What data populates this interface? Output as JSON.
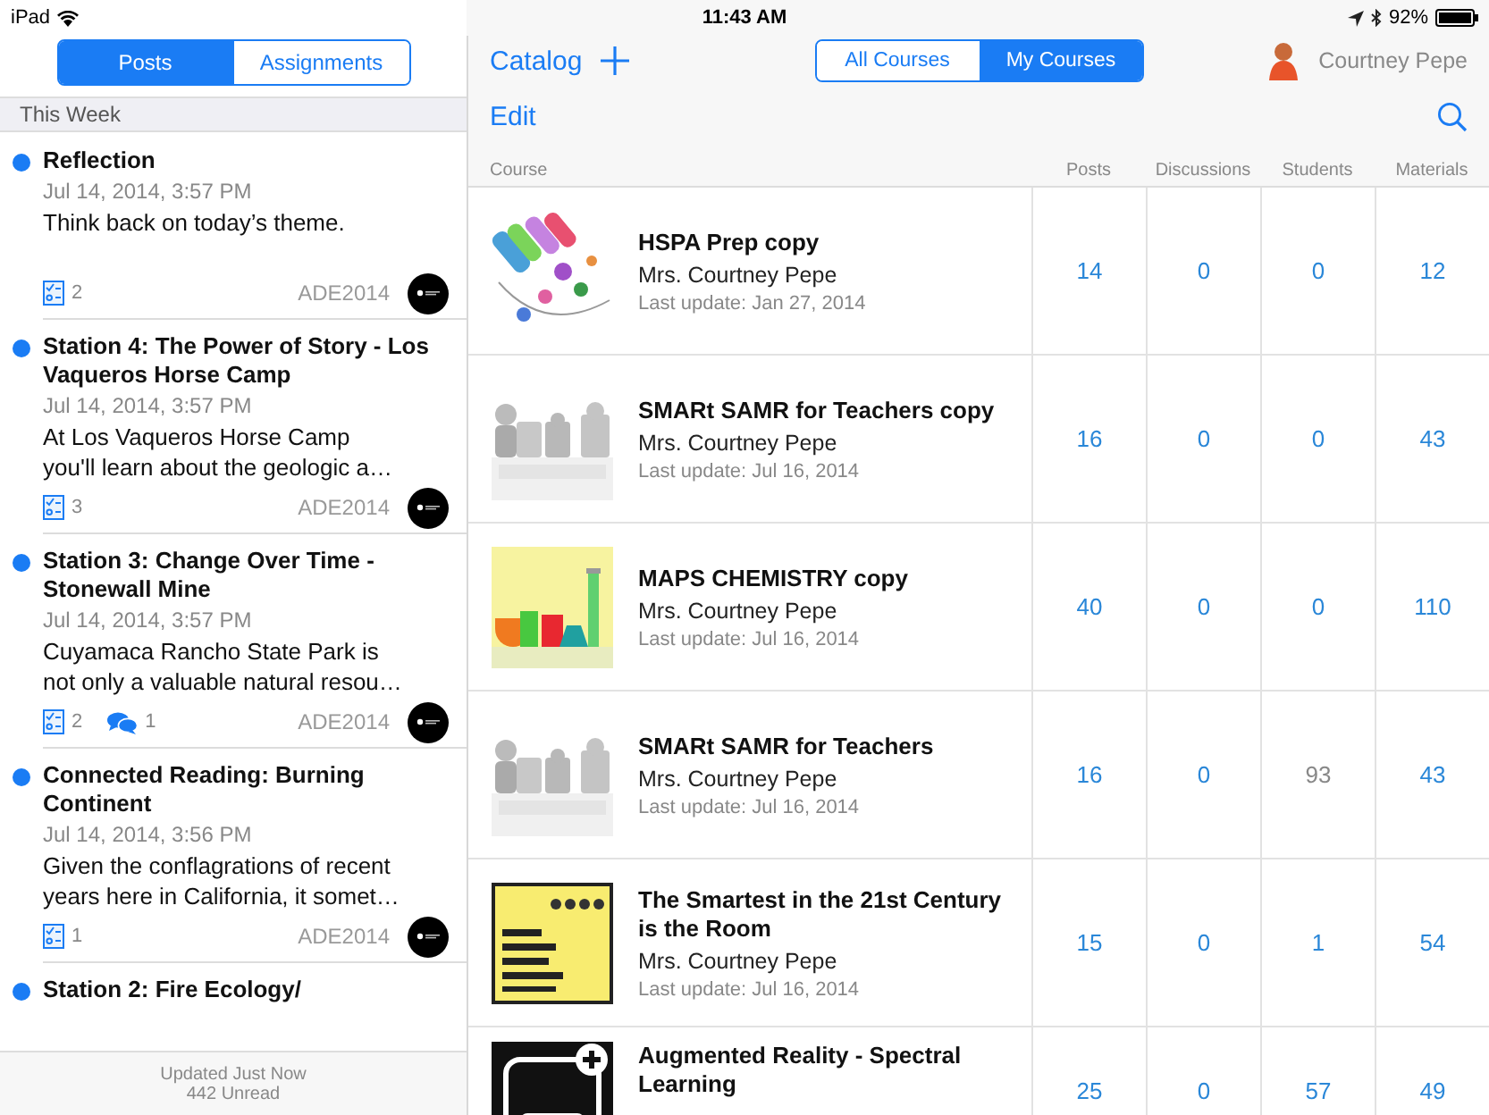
{
  "status_bar": {
    "device": "iPad",
    "time": "11:43 AM",
    "battery": "92%"
  },
  "posts_pane": {
    "tabs": [
      {
        "label": "Posts",
        "selected": true
      },
      {
        "label": "Assignments",
        "selected": false
      }
    ],
    "section": "This Week",
    "posts": [
      {
        "title": "Reflection",
        "unread": true,
        "date": "Jul 14, 2014, 3:57 PM",
        "excerpt_lines": [
          "Think back on today’s theme."
        ],
        "tasks": "2",
        "tag": "ADE2014"
      },
      {
        "title": "Station 4: The Power of Story - Los Vaqueros Horse Camp",
        "unread": true,
        "date": "Jul 14, 2014, 3:57 PM",
        "excerpt_lines": [
          "At Los Vaqueros Horse Camp",
          "you'll learn about the geologic a…"
        ],
        "tasks": "3",
        "tag": "ADE2014"
      },
      {
        "title": "Station 3: Change Over Time - Stonewall Mine",
        "unread": true,
        "date": "Jul 14, 2014, 3:57 PM",
        "excerpt_lines": [
          "Cuyamaca Rancho State Park is",
          "not only a valuable natural resou…"
        ],
        "tasks": "2",
        "comments": "1",
        "tag": "ADE2014"
      },
      {
        "title": "Connected Reading: Burning Continent",
        "unread": true,
        "date": "Jul 14, 2014, 3:56 PM",
        "excerpt_lines": [
          "Given the conflagrations of recent",
          "years here in California, it somet…"
        ],
        "tasks": "1",
        "tag": "ADE2014"
      },
      {
        "title": "Station 2: Fire Ecology/",
        "unread": true
      }
    ],
    "footer": {
      "updated": "Updated Just Now",
      "unread": "442 Unread"
    }
  },
  "courses_pane": {
    "catalog": "Catalog",
    "segments": [
      {
        "label": "All Courses",
        "selected": false
      },
      {
        "label": "My Courses",
        "selected": true
      }
    ],
    "user": "Courtney Pepe",
    "edit": "Edit",
    "course_column": "Course",
    "count_columns": [
      "Posts",
      "Discussions",
      "Students",
      "Materials"
    ],
    "rows": [
      {
        "title": "HSPA Prep copy",
        "teacher": "Mrs. Courtney Pepe",
        "updated": "Last update: Jan 27, 2014",
        "cells": [
          {
            "value": "14",
            "dimmed": false
          },
          {
            "value": "0",
            "dimmed": false
          },
          {
            "value": "0",
            "dimmed": false
          },
          {
            "value": "12",
            "dimmed": false
          }
        ]
      },
      {
        "title": "SMARt SAMR for Teachers copy",
        "teacher": "Mrs. Courtney Pepe",
        "updated": "Last update: Jul 16, 2014",
        "cells": [
          {
            "value": "16",
            "dimmed": false
          },
          {
            "value": "0",
            "dimmed": false
          },
          {
            "value": "0",
            "dimmed": false
          },
          {
            "value": "43",
            "dimmed": false
          }
        ]
      },
      {
        "title": "MAPS CHEMISTRY copy",
        "teacher": "Mrs. Courtney Pepe",
        "updated": "Last update: Jul 16, 2014",
        "cells": [
          {
            "value": "40",
            "dimmed": false
          },
          {
            "value": "0",
            "dimmed": false
          },
          {
            "value": "0",
            "dimmed": false
          },
          {
            "value": "110",
            "dimmed": false
          }
        ]
      },
      {
        "title": "SMARt SAMR for Teachers",
        "teacher": "Mrs. Courtney Pepe",
        "updated": "Last update: Jul 16, 2014",
        "cells": [
          {
            "value": "16",
            "dimmed": false
          },
          {
            "value": "0",
            "dimmed": false
          },
          {
            "value": "93",
            "dimmed": true
          },
          {
            "value": "43",
            "dimmed": false
          }
        ]
      },
      {
        "title": "The Smartest in the 21st Century is the Room",
        "teacher": "Mrs. Courtney Pepe",
        "updated": "Last update: Jul 16, 2014",
        "cells": [
          {
            "value": "15",
            "dimmed": false
          },
          {
            "value": "0",
            "dimmed": false
          },
          {
            "value": "1",
            "dimmed": false
          },
          {
            "value": "54",
            "dimmed": false
          }
        ]
      },
      {
        "title": "Augmented Reality - Spectral Learning",
        "cells": [
          {
            "value": "25",
            "dimmed": false
          },
          {
            "value": "0",
            "dimmed": false
          },
          {
            "value": "57",
            "dimmed": false
          },
          {
            "value": "49",
            "dimmed": false
          }
        ]
      }
    ]
  }
}
